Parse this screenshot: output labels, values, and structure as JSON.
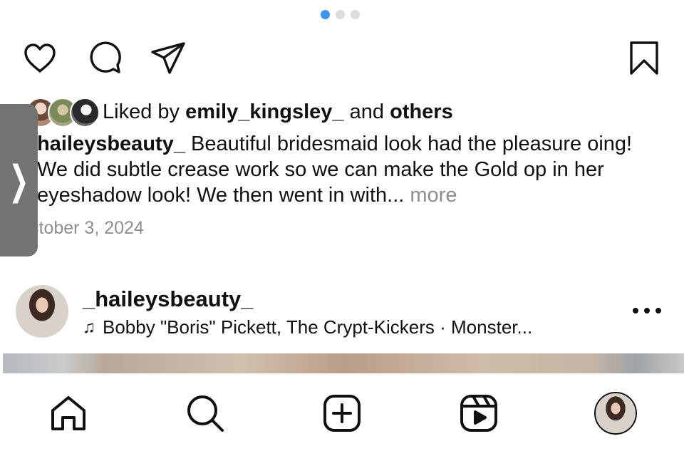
{
  "carousel": {
    "total": 3,
    "active_index": 0
  },
  "liked_by": {
    "prefix": "Liked by",
    "user": "emily_kingsley_",
    "conjunction": "and",
    "others": "others"
  },
  "caption": {
    "username": "haileysbeauty_",
    "text": "Beautiful bridesmaid look had the pleasure oing! We did subtle crease work so we can make the Gold op in her eyeshadow look! We then went in with...",
    "more_label": "more"
  },
  "post_date": "ctober 3, 2024",
  "next_post": {
    "username": "_haileysbeauty_",
    "music": "Bobby \"Boris\" Pickett, The Crypt-Kickers · Monster..."
  },
  "side_tab": {
    "glyph": "❯"
  },
  "icons": {
    "like": "heart-icon",
    "comment": "comment-icon",
    "share": "send-icon",
    "save": "bookmark-icon",
    "music": "music-note-icon",
    "more": "more-dots-icon",
    "home": "home-icon",
    "search": "search-icon",
    "create": "create-post-icon",
    "reels": "reels-icon"
  },
  "colors": {
    "active_dot": "#3897f0",
    "secondary_text": "#8e8e8e",
    "side_tab": "#737373"
  }
}
